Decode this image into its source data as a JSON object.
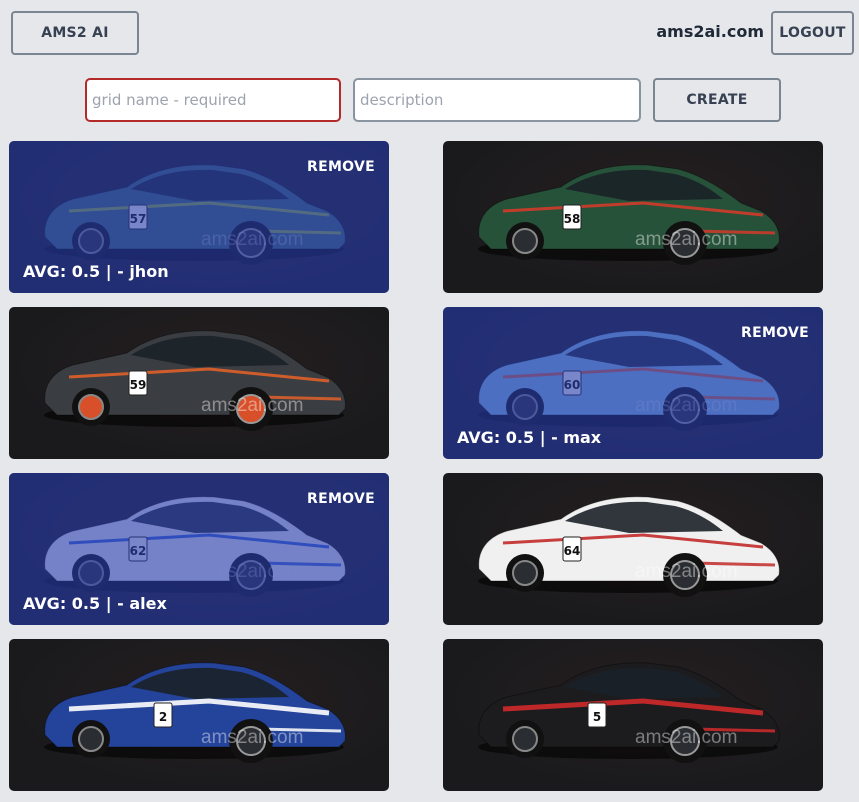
{
  "header": {
    "brand_label": "AMS2 AI",
    "site_name": "ams2ai.com",
    "logout_label": "LOGOUT"
  },
  "form": {
    "grid_name_placeholder": "grid name - required",
    "grid_name_value": "",
    "description_placeholder": "description",
    "description_value": "",
    "create_label": "CREATE"
  },
  "cards": [
    {
      "number": "57",
      "body": "#3f6a72",
      "stripe": "#a4c23a",
      "wheel": "#2a2e32",
      "selected": true,
      "remove_label": "REMOVE",
      "avg_label": "AVG: 0.5 | - jhon",
      "watermark": "ams2ai.com"
    },
    {
      "number": "58",
      "body": "#27523a",
      "stripe": "#d23a2a",
      "wheel": "#2a2e32",
      "selected": false,
      "remove_label": "",
      "avg_label": "",
      "watermark": "ams2ai.com"
    },
    {
      "number": "59",
      "body": "#3a3d42",
      "stripe": "#e0602a",
      "wheel": "#d8502a",
      "selected": false,
      "remove_label": "",
      "avg_label": "",
      "watermark": "ams2ai.com"
    },
    {
      "number": "60",
      "body": "#86c3e8",
      "stripe": "#e2623a",
      "wheel": "#2a2e32",
      "selected": true,
      "remove_label": "REMOVE",
      "avg_label": "AVG: 0.5 | - max",
      "watermark": "ams2ai.com"
    },
    {
      "number": "62",
      "body": "#f2f4f7",
      "stripe": "#2a5bd8",
      "wheel": "#2a2e32",
      "selected": true,
      "remove_label": "REMOVE",
      "avg_label": "AVG: 0.5 | - alex",
      "watermark": "ams2ai.com"
    },
    {
      "number": "64",
      "body": "#f0f0f0",
      "stripe": "#c22a2a",
      "wheel": "#2a2e32",
      "selected": false,
      "remove_label": "",
      "avg_label": "",
      "watermark": "ams2ai.com"
    },
    {
      "number": "2",
      "body": "#24439a",
      "stripe": "#ffffff",
      "wheel": "#2a2e32",
      "selected": false,
      "remove_label": "",
      "avg_label": "",
      "watermark": "ams2ai.com"
    },
    {
      "number": "5",
      "body": "#1c1c1e",
      "stripe": "#d22a2a",
      "wheel": "#2a2e32",
      "selected": false,
      "remove_label": "",
      "avg_label": "",
      "watermark": "ams2ai.com"
    }
  ]
}
